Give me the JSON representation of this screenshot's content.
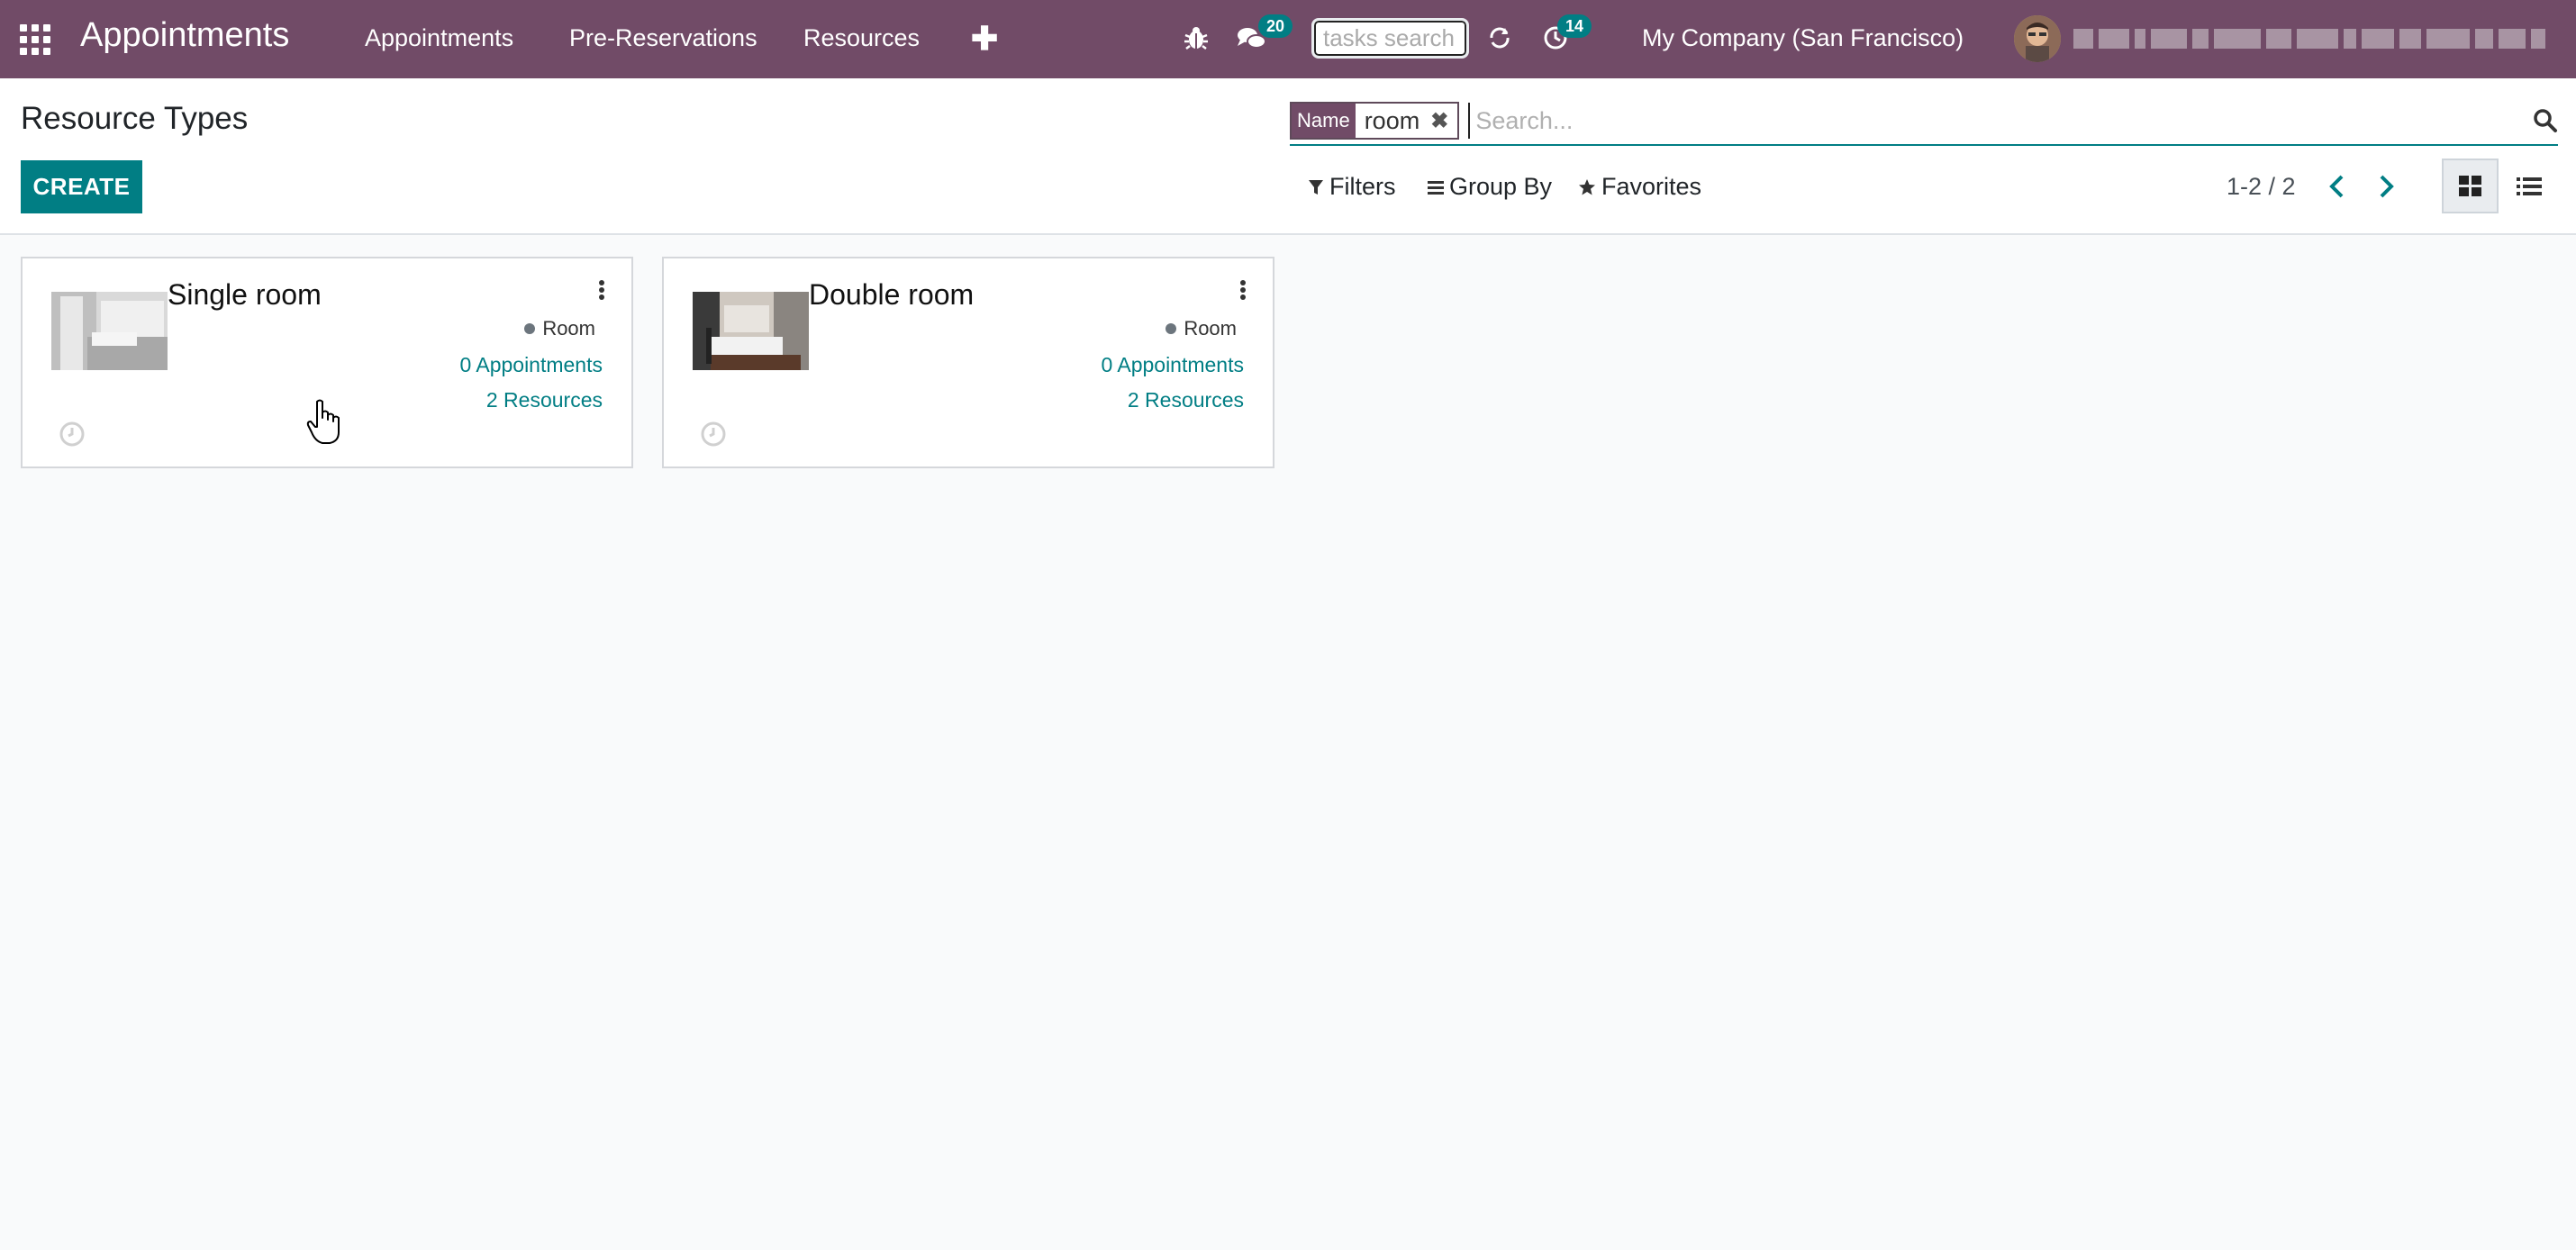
{
  "navbar": {
    "app_title": "Appointments",
    "menu": [
      "Appointments",
      "Pre-Reservations",
      "Resources"
    ],
    "messages_count": "20",
    "tasks_search_placeholder": "tasks search",
    "activities_count": "14",
    "company": "My Company (San Francisco)"
  },
  "control_panel": {
    "title": "Resource Types",
    "create_label": "CREATE",
    "search": {
      "facet_label": "Name",
      "facet_value": "room",
      "placeholder": "Search..."
    },
    "filters_label": "Filters",
    "groupby_label": "Group By",
    "favorites_label": "Favorites",
    "pager": "1-2 / 2"
  },
  "cards": [
    {
      "title": "Single room",
      "tag": "Room",
      "appointments": "0 Appointments",
      "resources": "2 Resources"
    },
    {
      "title": "Double room",
      "tag": "Room",
      "appointments": "0 Appointments",
      "resources": "2 Resources"
    }
  ],
  "colors": {
    "navbar": "#714B67",
    "primary": "#017e84",
    "background": "#f9fafb"
  }
}
